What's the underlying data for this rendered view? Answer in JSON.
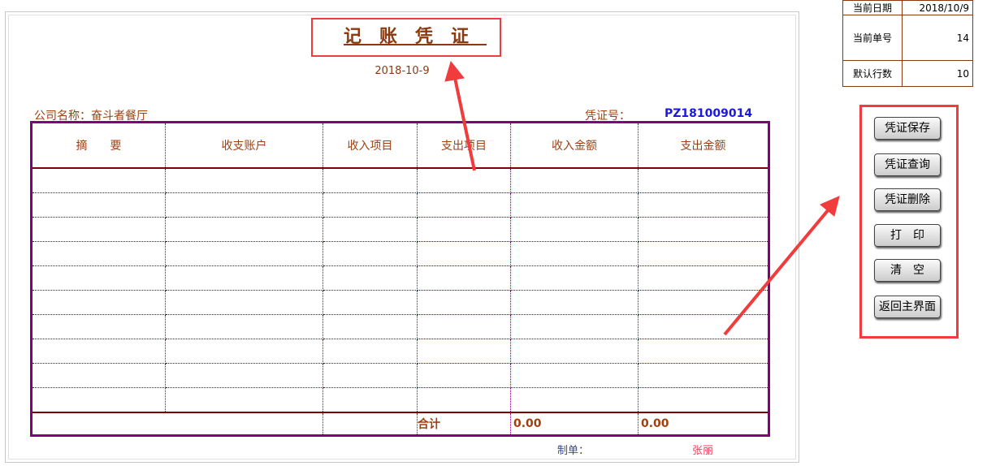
{
  "title": "记账凭证",
  "date": "2018-10-9",
  "company_label": "公司名称：奋斗者餐厅",
  "voucher_label": "凭证号：",
  "voucher_no": "PZ181009014",
  "columns": [
    "摘　　要",
    "收支账户",
    "收入项目",
    "支出项目",
    "收入金额",
    "支出金额"
  ],
  "total_label": "合计",
  "income_total": "0.00",
  "expense_total": "0.00",
  "maker_label": "制单：",
  "maker": "张丽",
  "info": [
    {
      "k": "当前日期",
      "v": "2018/10/9"
    },
    {
      "k": "当前单号",
      "v": "14"
    },
    {
      "k": "默认行数",
      "v": "10"
    }
  ],
  "buttons": [
    "凭证保存",
    "凭证查询",
    "凭证删除",
    "打　印",
    "清　空",
    "返回主界面"
  ],
  "colors": {
    "annotation": "#f03c3c",
    "border": "#800080"
  }
}
